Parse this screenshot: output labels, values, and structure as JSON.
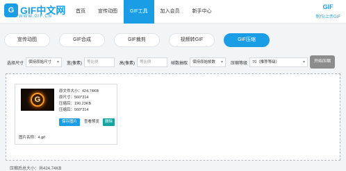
{
  "header": {
    "logo_mark": "G",
    "logo_text": "GIF中文网",
    "logo_domain": "WWW.GIF.CN",
    "nav": [
      "首页",
      "宣传动图",
      "GIF工具",
      "加入会员",
      "新手中心"
    ],
    "user_name": "GIF",
    "user_link": "制作/上传GIF",
    "accent": "#1a9de4"
  },
  "tabs": [
    "宣传动图",
    "GIF合成",
    "GIF裁剪",
    "视频转GIF",
    "GIF压缩"
  ],
  "controls": {
    "size_label": "选择尺寸",
    "size_value": "保持原始尺寸",
    "width_label": "宽(像素)",
    "width_placeholder": "等比例",
    "height_label": "高(像素)",
    "height_placeholder": "等比例",
    "fps_label": "帧数抽取",
    "fps_value": "保持原始帧数",
    "level_label": "压缩等级",
    "level_value": "70（推荐等级）",
    "start_button": "开始压缩"
  },
  "file": {
    "orig_size": "原文件大小：424.74KB",
    "orig_dims": "原尺寸：560*314",
    "new_size": "压缩后：190.23KB",
    "new_dims": "压缩后：560*314",
    "download": "保存图片",
    "preview": "查看预览",
    "delete": "删除",
    "filename": "图片名称：4.gif"
  },
  "summary": "压缩后总大小：共424.74KB"
}
